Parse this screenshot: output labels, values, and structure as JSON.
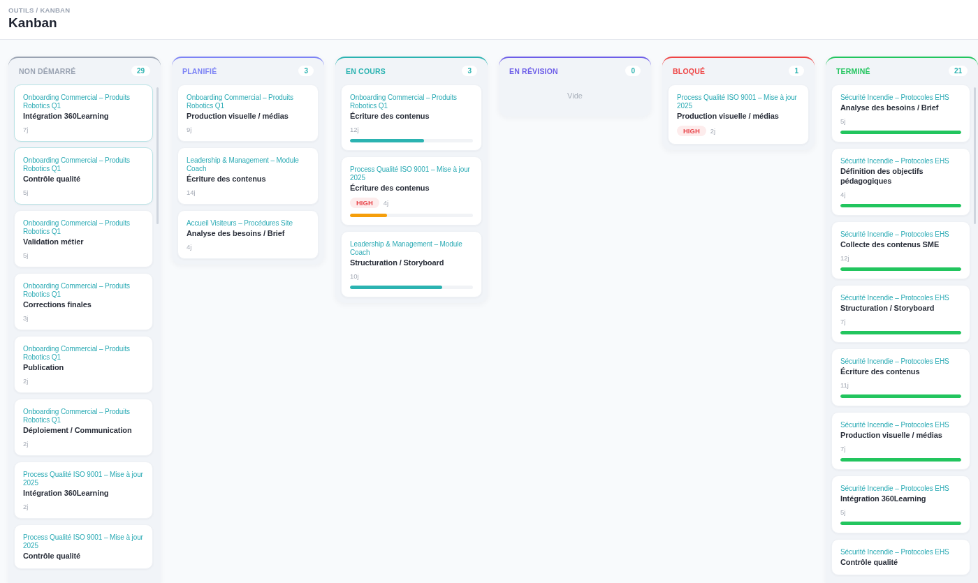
{
  "header": {
    "breadcrumb": "OUTILS / KANBAN",
    "title": "Kanban"
  },
  "columns": [
    {
      "title": "NON DÉMARRÉ",
      "count": "29",
      "color": "#9aa3b2",
      "scrollable": true,
      "cards": [
        {
          "project": "Onboarding Commercial – Produits Robotics Q1",
          "task": "Intégration 360Learning",
          "duration": "7j",
          "selected": true
        },
        {
          "project": "Onboarding Commercial – Produits Robotics Q1",
          "task": "Contrôle qualité",
          "duration": "5j",
          "selected": true
        },
        {
          "project": "Onboarding Commercial – Produits Robotics Q1",
          "task": "Validation métier",
          "duration": "5j",
          "selected": false
        },
        {
          "project": "Onboarding Commercial – Produits Robotics Q1",
          "task": "Corrections finales",
          "duration": "3j",
          "selected": false
        },
        {
          "project": "Onboarding Commercial – Produits Robotics Q1",
          "task": "Publication",
          "duration": "2j",
          "selected": false
        },
        {
          "project": "Onboarding Commercial – Produits Robotics Q1",
          "task": "Déploiement / Communication",
          "duration": "2j",
          "selected": false
        },
        {
          "project": "Process Qualité ISO 9001 – Mise à jour 2025",
          "task": "Intégration 360Learning",
          "duration": "2j",
          "selected": false
        },
        {
          "project": "Process Qualité ISO 9001 – Mise à jour 2025",
          "task": "Contrôle qualité",
          "selected": false
        }
      ]
    },
    {
      "title": "PLANIFIÉ",
      "count": "3",
      "color": "#7c83f5",
      "scrollable": false,
      "cards": [
        {
          "project": "Onboarding Commercial – Produits Robotics Q1",
          "task": "Production visuelle / médias",
          "duration": "9j",
          "selected": false
        },
        {
          "project": "Leadership & Management – Module Coach",
          "task": "Écriture des contenus",
          "duration": "14j",
          "selected": false
        },
        {
          "project": "Accueil Visiteurs – Procédures Site",
          "task": "Analyse des besoins / Brief",
          "duration": "4j",
          "selected": false
        }
      ]
    },
    {
      "title": "EN COURS",
      "count": "3",
      "color": "#2bb3b1",
      "scrollable": false,
      "cards": [
        {
          "project": "Onboarding Commercial – Produits Robotics Q1",
          "task": "Écriture des contenus",
          "duration": "12j",
          "selected": false,
          "progress": {
            "level": 0.6,
            "color": "#2bb3b1"
          }
        },
        {
          "project": "Process Qualité ISO 9001 – Mise à jour 2025",
          "task": "Écriture des contenus",
          "priority": "HIGH",
          "duration": "4j",
          "selected": false,
          "progress": {
            "level": 0.3,
            "color": "#f59e0b"
          }
        },
        {
          "project": "Leadership & Management – Module Coach",
          "task": "Structuration / Storyboard",
          "duration": "10j",
          "selected": false,
          "progress": {
            "level": 0.75,
            "color": "#2bb3b1"
          }
        }
      ]
    },
    {
      "title": "EN RÉVISION",
      "count": "0",
      "color": "#6d5ee8",
      "scrollable": false,
      "empty_text": "Vide"
    },
    {
      "title": "BLOQUÉ",
      "count": "1",
      "color": "#ef4444",
      "scrollable": false,
      "cards": [
        {
          "project": "Process Qualité ISO 9001 – Mise à jour 2025",
          "task": "Production visuelle / médias",
          "priority": "HIGH",
          "duration": "2j",
          "selected": false
        }
      ]
    },
    {
      "title": "TERMINÉ",
      "count": "21",
      "color": "#22c55e",
      "scrollable": true,
      "cards": [
        {
          "project": "Sécurité Incendie – Protocoles EHS",
          "task": "Analyse des besoins / Brief",
          "duration": "5j",
          "selected": false,
          "progress": {
            "level": 1,
            "color": "#22c55e"
          }
        },
        {
          "project": "Sécurité Incendie – Protocoles EHS",
          "task": "Définition des objectifs pédagogiques",
          "duration": "4j",
          "selected": false,
          "progress": {
            "level": 1,
            "color": "#22c55e"
          }
        },
        {
          "project": "Sécurité Incendie – Protocoles EHS",
          "task": "Collecte des contenus SME",
          "duration": "12j",
          "selected": false,
          "progress": {
            "level": 1,
            "color": "#22c55e"
          }
        },
        {
          "project": "Sécurité Incendie – Protocoles EHS",
          "task": "Structuration / Storyboard",
          "duration": "7j",
          "selected": false,
          "progress": {
            "level": 1,
            "color": "#22c55e"
          }
        },
        {
          "project": "Sécurité Incendie – Protocoles EHS",
          "task": "Écriture des contenus",
          "duration": "11j",
          "selected": false,
          "progress": {
            "level": 1,
            "color": "#22c55e"
          }
        },
        {
          "project": "Sécurité Incendie – Protocoles EHS",
          "task": "Production visuelle / médias",
          "duration": "7j",
          "selected": false,
          "progress": {
            "level": 1,
            "color": "#22c55e"
          }
        },
        {
          "project": "Sécurité Incendie – Protocoles EHS",
          "task": "Intégration 360Learning",
          "duration": "5j",
          "selected": false,
          "progress": {
            "level": 1,
            "color": "#22c55e"
          }
        },
        {
          "project": "Sécurité Incendie – Protocoles EHS",
          "task": "Contrôle qualité",
          "selected": false
        }
      ]
    }
  ]
}
